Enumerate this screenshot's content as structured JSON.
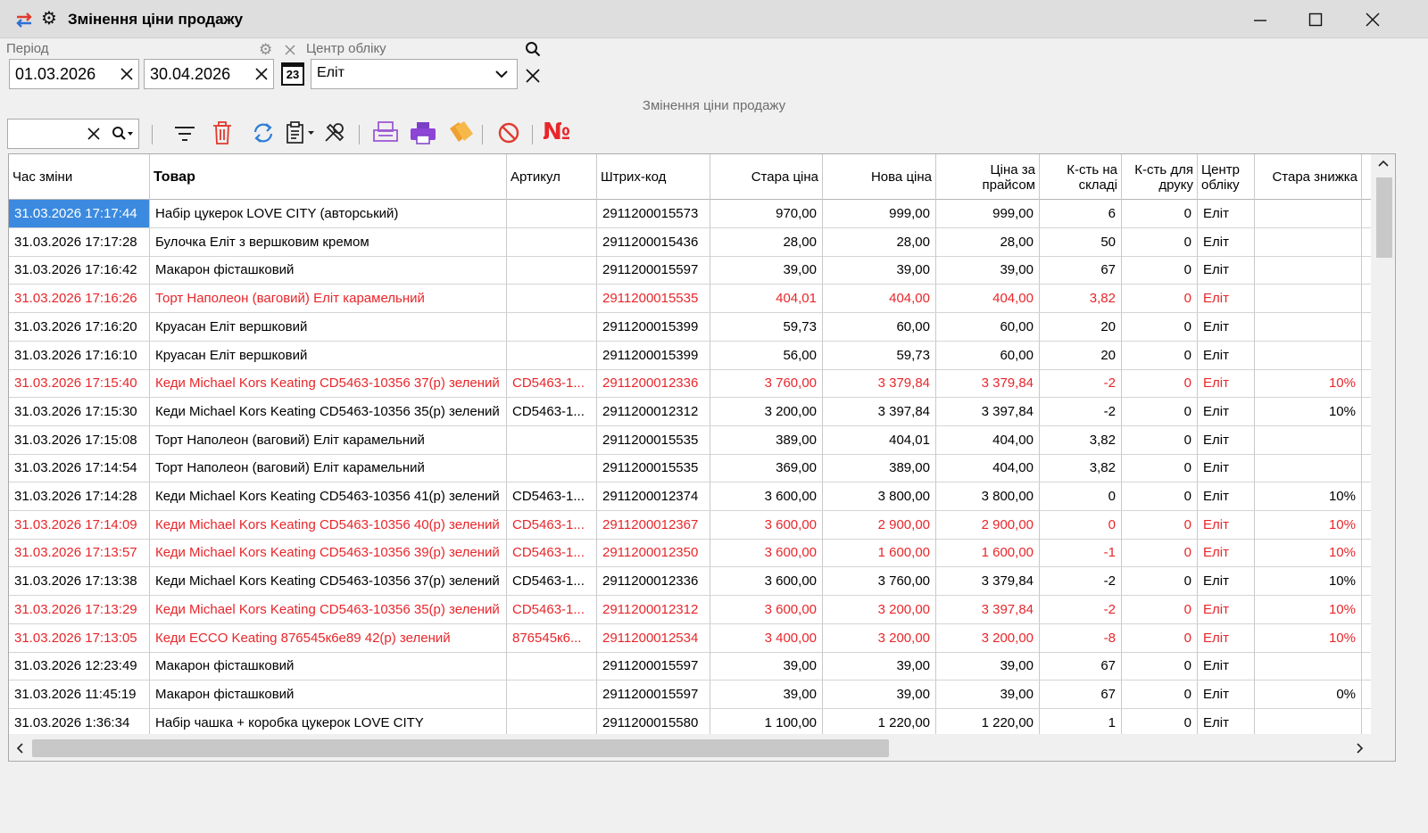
{
  "window": {
    "title": "Змінення ціни продажу",
    "subtitle": "Змінення ціни продажу"
  },
  "filters": {
    "period_label": "Період",
    "date_from": "01.03.2026",
    "date_to": "30.04.2026",
    "calendar_day": "23",
    "center_label": "Центр обліку",
    "center_value": "Еліт"
  },
  "columns": {
    "time": "Час зміни",
    "product": "Товар",
    "article": "Артикул",
    "barcode": "Штрих-код",
    "old_price": "Стара ціна",
    "new_price": "Нова ціна",
    "list_price": "Ціна за прайсом",
    "stock": "К-сть на складі",
    "print_qty": "К-сть для друку",
    "center": "Центр обліку",
    "old_discount": "Стара знижка"
  },
  "rows": [
    {
      "time": "31.03.2026 17:17:44",
      "product": "Набір цукерок LOVE CITY (авторський)",
      "article": "",
      "barcode": "2911200015573",
      "old": "970,00",
      "new": "999,00",
      "list": "999,00",
      "stock": "6",
      "print": "0",
      "center": "Еліт",
      "disc": "",
      "red": false,
      "sel": true
    },
    {
      "time": "31.03.2026 17:17:28",
      "product": "Булочка Еліт з вершковим кремом",
      "article": "",
      "barcode": "2911200015436",
      "old": "28,00",
      "new": "28,00",
      "list": "28,00",
      "stock": "50",
      "print": "0",
      "center": "Еліт",
      "disc": "",
      "red": false
    },
    {
      "time": "31.03.2026 17:16:42",
      "product": "Макарон фісташковий",
      "article": "",
      "barcode": "2911200015597",
      "old": "39,00",
      "new": "39,00",
      "list": "39,00",
      "stock": "67",
      "print": "0",
      "center": "Еліт",
      "disc": "",
      "red": false
    },
    {
      "time": "31.03.2026 17:16:26",
      "product": "Торт Наполеон (ваговий) Еліт карамельний",
      "article": "",
      "barcode": "2911200015535",
      "old": "404,01",
      "new": "404,00",
      "list": "404,00",
      "stock": "3,82",
      "print": "0",
      "center": "Еліт",
      "disc": "",
      "red": true
    },
    {
      "time": "31.03.2026 17:16:20",
      "product": "Круасан Еліт вершковий",
      "article": "",
      "barcode": "2911200015399",
      "old": "59,73",
      "new": "60,00",
      "list": "60,00",
      "stock": "20",
      "print": "0",
      "center": "Еліт",
      "disc": "",
      "red": false
    },
    {
      "time": "31.03.2026 17:16:10",
      "product": "Круасан Еліт вершковий",
      "article": "",
      "barcode": "2911200015399",
      "old": "56,00",
      "new": "59,73",
      "list": "60,00",
      "stock": "20",
      "print": "0",
      "center": "Еліт",
      "disc": "",
      "red": false
    },
    {
      "time": "31.03.2026 17:15:40",
      "product": "Кеди Michael Kors Keating CD5463-10356 37(р) зелений",
      "article": "CD5463-1...",
      "barcode": "2911200012336",
      "old": "3 760,00",
      "new": "3 379,84",
      "list": "3 379,84",
      "stock": "-2",
      "print": "0",
      "center": "Еліт",
      "disc": "10%",
      "red": true
    },
    {
      "time": "31.03.2026 17:15:30",
      "product": "Кеди Michael Kors Keating CD5463-10356 35(р) зелений",
      "article": "CD5463-1...",
      "barcode": "2911200012312",
      "old": "3 200,00",
      "new": "3 397,84",
      "list": "3 397,84",
      "stock": "-2",
      "print": "0",
      "center": "Еліт",
      "disc": "10%",
      "red": false
    },
    {
      "time": "31.03.2026 17:15:08",
      "product": "Торт Наполеон (ваговий) Еліт карамельний",
      "article": "",
      "barcode": "2911200015535",
      "old": "389,00",
      "new": "404,01",
      "list": "404,00",
      "stock": "3,82",
      "print": "0",
      "center": "Еліт",
      "disc": "",
      "red": false
    },
    {
      "time": "31.03.2026 17:14:54",
      "product": "Торт Наполеон (ваговий) Еліт карамельний",
      "article": "",
      "barcode": "2911200015535",
      "old": "369,00",
      "new": "389,00",
      "list": "404,00",
      "stock": "3,82",
      "print": "0",
      "center": "Еліт",
      "disc": "",
      "red": false
    },
    {
      "time": "31.03.2026 17:14:28",
      "product": "Кеди Michael Kors Keating CD5463-10356 41(р) зелений",
      "article": "CD5463-1...",
      "barcode": "2911200012374",
      "old": "3 600,00",
      "new": "3 800,00",
      "list": "3 800,00",
      "stock": "0",
      "print": "0",
      "center": "Еліт",
      "disc": "10%",
      "red": false
    },
    {
      "time": "31.03.2026 17:14:09",
      "product": "Кеди Michael Kors Keating CD5463-10356 40(р) зелений",
      "article": "CD5463-1...",
      "barcode": "2911200012367",
      "old": "3 600,00",
      "new": "2 900,00",
      "list": "2 900,00",
      "stock": "0",
      "print": "0",
      "center": "Еліт",
      "disc": "10%",
      "red": true
    },
    {
      "time": "31.03.2026 17:13:57",
      "product": "Кеди Michael Kors Keating CD5463-10356 39(р) зелений",
      "article": "CD5463-1...",
      "barcode": "2911200012350",
      "old": "3 600,00",
      "new": "1 600,00",
      "list": "1 600,00",
      "stock": "-1",
      "print": "0",
      "center": "Еліт",
      "disc": "10%",
      "red": true
    },
    {
      "time": "31.03.2026 17:13:38",
      "product": "Кеди Michael Kors Keating CD5463-10356 37(р) зелений",
      "article": "CD5463-1...",
      "barcode": "2911200012336",
      "old": "3 600,00",
      "new": "3 760,00",
      "list": "3 379,84",
      "stock": "-2",
      "print": "0",
      "center": "Еліт",
      "disc": "10%",
      "red": false
    },
    {
      "time": "31.03.2026 17:13:29",
      "product": "Кеди Michael Kors Keating CD5463-10356 35(р) зелений",
      "article": "CD5463-1...",
      "barcode": "2911200012312",
      "old": "3 600,00",
      "new": "3 200,00",
      "list": "3 397,84",
      "stock": "-2",
      "print": "0",
      "center": "Еліт",
      "disc": "10%",
      "red": true
    },
    {
      "time": "31.03.2026 17:13:05",
      "product": "Кеди ECCO Keating 876545к6е89 42(р) зелений",
      "article": "876545к6...",
      "barcode": "2911200012534",
      "old": "3 400,00",
      "new": "3 200,00",
      "list": "3 200,00",
      "stock": "-8",
      "print": "0",
      "center": "Еліт",
      "disc": "10%",
      "red": true
    },
    {
      "time": "31.03.2026 12:23:49",
      "product": "Макарон фісташковий",
      "article": "",
      "barcode": "2911200015597",
      "old": "39,00",
      "new": "39,00",
      "list": "39,00",
      "stock": "67",
      "print": "0",
      "center": "Еліт",
      "disc": "",
      "red": false
    },
    {
      "time": "31.03.2026 11:45:19",
      "product": "Макарон фісташковий",
      "article": "",
      "barcode": "2911200015597",
      "old": "39,00",
      "new": "39,00",
      "list": "39,00",
      "stock": "67",
      "print": "0",
      "center": "Еліт",
      "disc": "0%",
      "red": false
    },
    {
      "time": "31.03.2026 1:36:34",
      "product": "Набір чашка + коробка цукерок LOVE CITY",
      "article": "",
      "barcode": "2911200015580",
      "old": "1 100,00",
      "new": "1 220,00",
      "list": "1 220,00",
      "stock": "1",
      "print": "0",
      "center": "Еліт",
      "disc": "",
      "red": false
    }
  ]
}
